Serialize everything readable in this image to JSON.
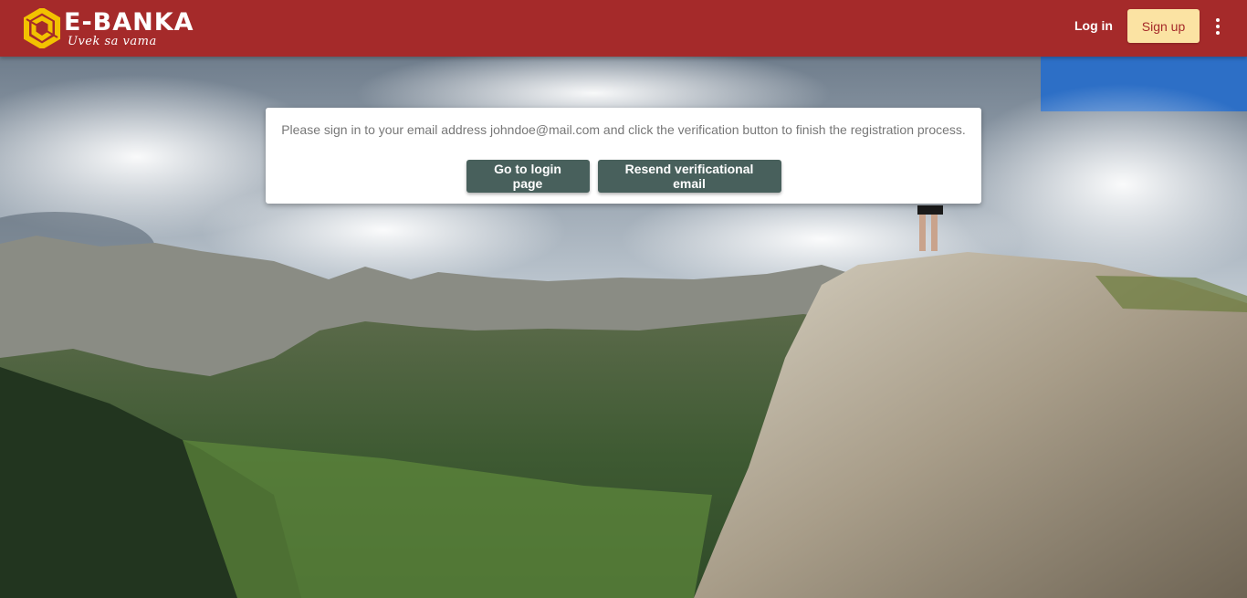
{
  "header": {
    "brand_name": "E-BANKA",
    "brand_tagline": "Uvek sa vama",
    "login_label": "Log in",
    "signup_label": "Sign up",
    "menu_icon": "more-vertical-icon"
  },
  "notice": {
    "message": "Please sign in to your email address johndoe@mail.com and click the verification button to finish the registration process.",
    "login_button": "Go to login page",
    "resend_button": "Resend verificational email"
  },
  "colors": {
    "header_bg": "#a52a2a",
    "signup_bg": "#fbe3a3",
    "button_bg": "#48605c",
    "logo_accent": "#f2c200"
  }
}
